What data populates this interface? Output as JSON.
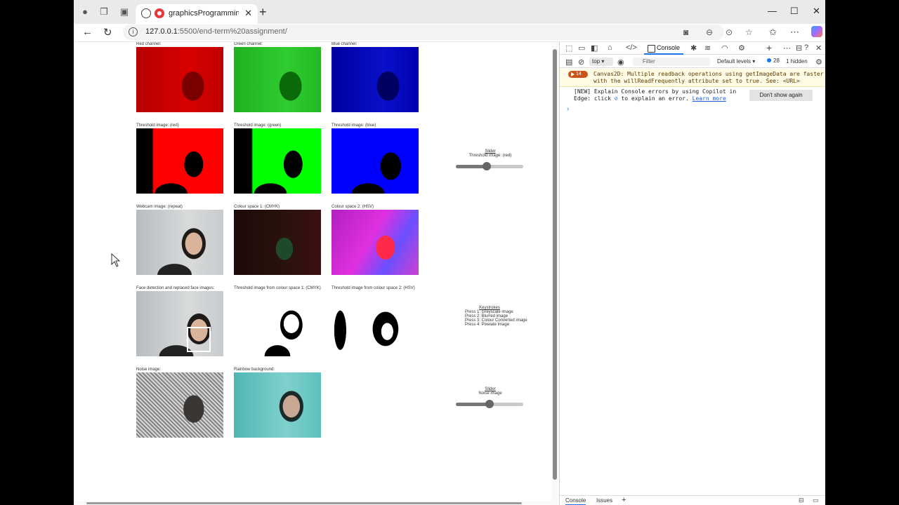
{
  "browser": {
    "tab_title": "graphicsProgramming - Cou",
    "url_host": "127.0.0.1",
    "url_rest": ":5500/end-term%20assignment/"
  },
  "page": {
    "rows": [
      [
        "Red channel:",
        "Green channel:",
        "Blue channel:"
      ],
      [
        "Threshold image: (red)",
        "Threshold image: (green)",
        "Threshold image: (blue)"
      ],
      [
        "Webcam image: (repeat)",
        "Colour space 1: (CMYK)",
        "Colour space 2: (HSV)"
      ],
      [
        "Face detection and replaced face images:",
        "Threshold image from colour space 1: (CMYK)",
        "Threshold image from colour space 2: (HSV)"
      ],
      [
        "Noise image:",
        "Rainbow background:"
      ]
    ],
    "slider1": {
      "title": "Slider",
      "label": "Threshold image: (red)",
      "value": 0.45
    },
    "slider2": {
      "title": "Slider",
      "label": "Noise image",
      "value": 0.5
    },
    "keystrokes": {
      "title": "Keystrokes",
      "items": [
        "Press 1: Greyscale image",
        "Press 2: Blurred image",
        "Press 3: Colour Converted image",
        "Press 4: Pixelate image"
      ]
    }
  },
  "devtools": {
    "active_tab": "Console",
    "context": "top",
    "filter_placeholder": "Filter",
    "levels": "Default levels",
    "issues_count": "28",
    "hidden": "1 hidden",
    "warning_count": "14",
    "warning_text": "Canvas2D: Multiple readback operations using getImageData are faster with the willReadFrequently attribute set to true. See: <URL>",
    "new_text_1": "[NEW] Explain Console errors by using Copilot in",
    "new_text_2": "Edge: click",
    "new_text_3": "to explain an error.",
    "learn_more": "Learn more",
    "dont_show": "Don't show again",
    "bottom_tabs": [
      "Console",
      "Issues"
    ]
  }
}
